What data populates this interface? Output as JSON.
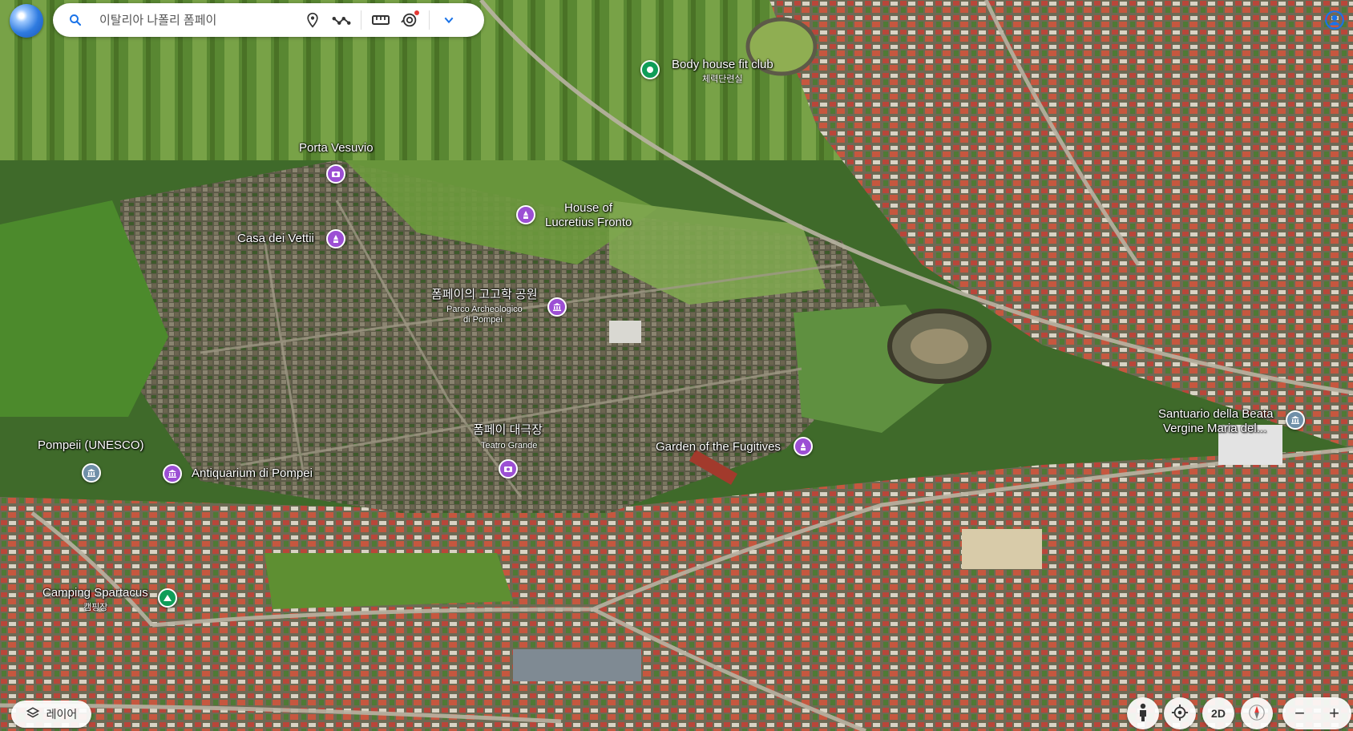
{
  "search": {
    "placeholder": "이탈리아 나폴리 폼페이"
  },
  "toolbar": {
    "icons": [
      "search-icon",
      "place-pin-icon",
      "path-icon",
      "ruler-icon",
      "projects-icon",
      "chevron-down-icon"
    ]
  },
  "places": {
    "body_house": {
      "name": "Body house fit club",
      "sub": "체력단련실",
      "color": "#0f9d58"
    },
    "porta_vesuvio": {
      "name": "Porta Vesuvio",
      "color": "#9c4fd4"
    },
    "lucretius": {
      "name_line1": "House of",
      "name_line2": "Lucretius Fronto",
      "color": "#9c4fd4"
    },
    "vettii": {
      "name": "Casa dei Vettii",
      "color": "#9c4fd4"
    },
    "park": {
      "name": "폼페이의 고고학 공원",
      "sub_line1": "Parco Archeologico",
      "sub_line2": "di Pompei",
      "color": "#9c4fd4"
    },
    "teatro": {
      "name": "폼페이 대극장",
      "sub": "Teatro Grande",
      "color": "#9c4fd4"
    },
    "fugitives": {
      "name": "Garden of the Fugitives",
      "color": "#9c4fd4"
    },
    "santuario": {
      "name_line1": "Santuario della Beata",
      "name_line2": "Vergine Maria del...",
      "color": "#6f8fa8"
    },
    "unesco": {
      "name": "Pompeii (UNESCO)",
      "color": "#6f8fa8"
    },
    "antiquarium": {
      "name": "Antiquarium di Pompei",
      "color": "#9c4fd4"
    },
    "camping": {
      "name": "Camping Spartacus",
      "sub": "캠핑장",
      "color": "#0f9d58"
    }
  },
  "controls": {
    "layers_label": "레이어",
    "mode_2d": "2D",
    "zoom_out": "−",
    "zoom_in": "+"
  }
}
